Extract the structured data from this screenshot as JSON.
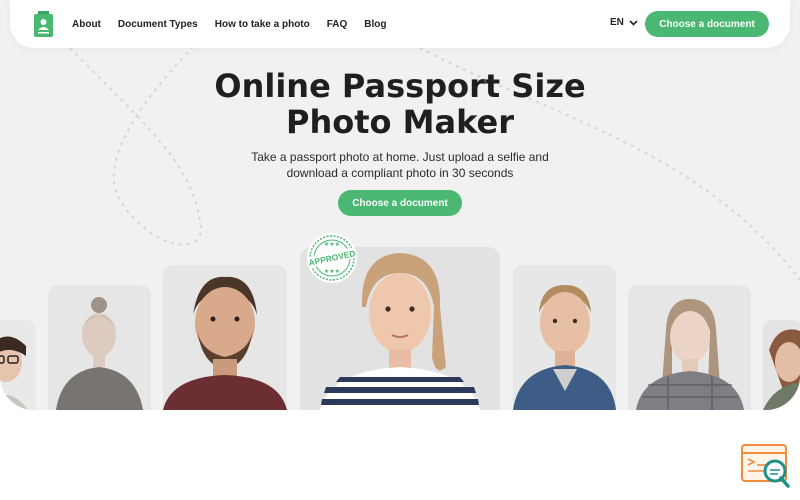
{
  "nav": {
    "logo_icon": "passport-photo-logo-icon",
    "links": [
      "About",
      "Document Types",
      "How to take a photo",
      "FAQ",
      "Blog"
    ],
    "language": "EN",
    "cta_label": "Choose a document"
  },
  "hero": {
    "title_line1": "Online Passport Size",
    "title_line2": "Photo Maker",
    "subtitle_line1": "Take a passport photo at home. Just upload a selfie and",
    "subtitle_line2": "download a compliant photo in 30 seconds",
    "cta_label": "Choose a document",
    "badge_text": "APPROVED"
  },
  "colors": {
    "accent": "#4ab872",
    "hero_background": "#f1f1f1",
    "widget_orange": "#f08a3c",
    "widget_teal": "#1f8f8a"
  },
  "widget_icon": "search-document-icon"
}
